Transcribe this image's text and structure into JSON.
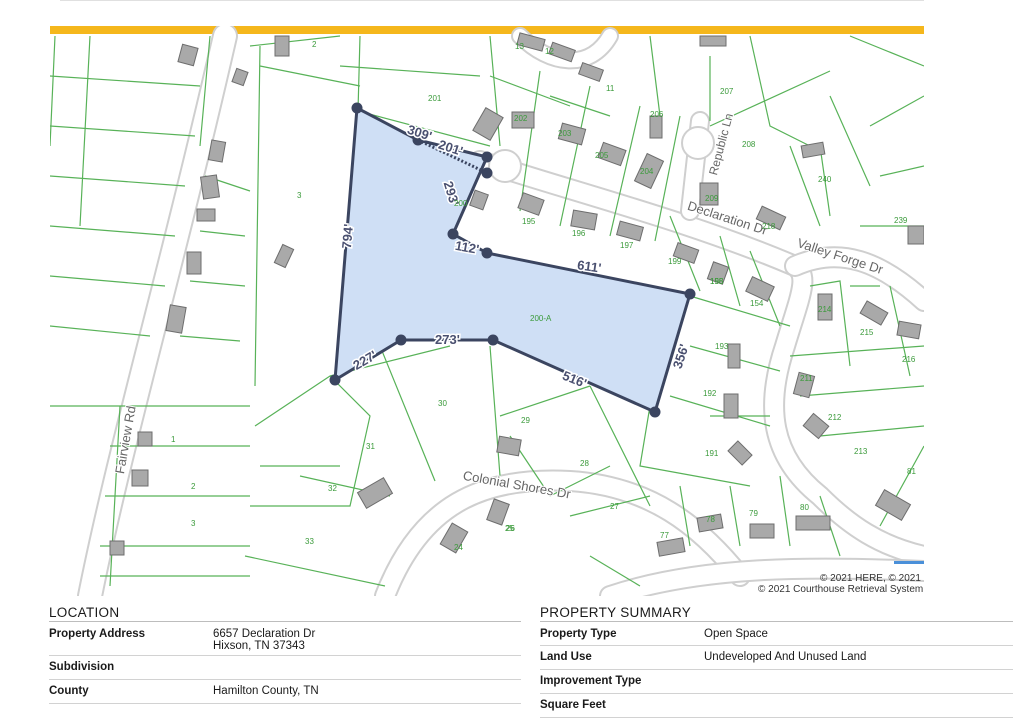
{
  "map": {
    "parcel_label": "200-A",
    "dimensions": [
      "309'",
      "201'",
      "293'",
      "112'",
      "611'",
      "794'",
      "227'",
      "273'",
      "516'",
      "356'"
    ],
    "streets": [
      "Declaration Dr",
      "Republic Ln",
      "Valley Forge Dr",
      "Fairview Rd",
      "Colonial Shores Dr"
    ],
    "lot_numbers": [
      "2",
      "13",
      "12",
      "11",
      "207",
      "201",
      "202",
      "203",
      "206",
      "205",
      "208",
      "3",
      "200",
      "204",
      "240",
      "239",
      "195",
      "196",
      "197",
      "199",
      "198",
      "209",
      "218",
      "155",
      "154",
      "214",
      "215",
      "216",
      "193",
      "192",
      "211",
      "212",
      "213",
      "191",
      "81",
      "1",
      "31",
      "30",
      "29",
      "28",
      "2",
      "32",
      "27",
      "78",
      "79",
      "80",
      "3",
      "33",
      "77",
      "26",
      "25",
      "24"
    ],
    "attribution": [
      "© 2021 HERE, © 2021 N",
      "© 2021 Courthouse Retrieval System,"
    ],
    "colors": {
      "header_bar": "#f5b71c",
      "parcel_fill": "#cfdff5",
      "parcel_stroke": "#3b4560",
      "lot_lines": "#58b258",
      "lot_numbers": "#3a9a3a",
      "road_text": "#666666"
    }
  },
  "location": {
    "title": "LOCATION",
    "rows": [
      {
        "label": "Property Address",
        "value_line1": "6657 Declaration Dr",
        "value_line2": "Hixson, TN 37343"
      },
      {
        "label": "Subdivision",
        "value": ""
      },
      {
        "label": "County",
        "value": "Hamilton County, TN"
      }
    ]
  },
  "summary": {
    "title": "PROPERTY SUMMARY",
    "rows": [
      {
        "label": "Property Type",
        "value": "Open Space"
      },
      {
        "label": "Land Use",
        "value": "Undeveloped And Unused Land"
      },
      {
        "label": "Improvement Type",
        "value": ""
      },
      {
        "label": "Square Feet",
        "value": ""
      }
    ]
  }
}
